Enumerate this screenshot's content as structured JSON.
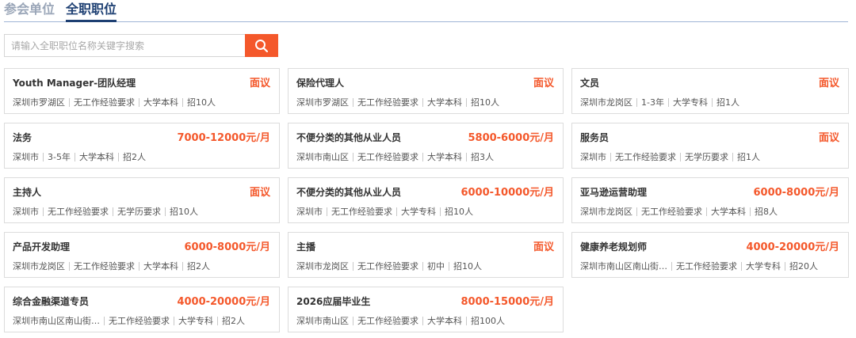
{
  "tabs": [
    {
      "label": "参会单位",
      "active": false
    },
    {
      "label": "全职职位",
      "active": true
    }
  ],
  "search": {
    "placeholder": "请输入全职职位名称关键字搜索",
    "value": ""
  },
  "colors": {
    "accent": "#f4582b",
    "tab_active": "#1d3f72",
    "tab_inactive": "#9aa6b8"
  },
  "jobs": [
    {
      "title": "Youth Manager-团队经理",
      "salary": "面议",
      "location": "深圳市罗湖区",
      "experience": "无工作经验要求",
      "education": "大学本科",
      "headcount": "招10人"
    },
    {
      "title": "保险代理人",
      "salary": "面议",
      "location": "深圳市罗湖区",
      "experience": "无工作经验要求",
      "education": "大学本科",
      "headcount": "招10人"
    },
    {
      "title": "文员",
      "salary": "面议",
      "location": "深圳市龙岗区",
      "experience": "1-3年",
      "education": "大学专科",
      "headcount": "招1人"
    },
    {
      "title": "法务",
      "salary": "7000-12000元/月",
      "location": "深圳市",
      "experience": "3-5年",
      "education": "大学本科",
      "headcount": "招2人"
    },
    {
      "title": "不便分类的其他从业人员",
      "salary": "5800-6000元/月",
      "location": "深圳市南山区",
      "experience": "无工作经验要求",
      "education": "大学本科",
      "headcount": "招3人"
    },
    {
      "title": "服务员",
      "salary": "面议",
      "location": "深圳市",
      "experience": "无工作经验要求",
      "education": "无学历要求",
      "headcount": "招1人"
    },
    {
      "title": "主持人",
      "salary": "面议",
      "location": "深圳市",
      "experience": "无工作经验要求",
      "education": "无学历要求",
      "headcount": "招10人"
    },
    {
      "title": "不便分类的其他从业人员",
      "salary": "6000-10000元/月",
      "location": "深圳市",
      "experience": "无工作经验要求",
      "education": "大学专科",
      "headcount": "招10人"
    },
    {
      "title": "亚马逊运营助理",
      "salary": "6000-8000元/月",
      "location": "深圳市龙岗区",
      "experience": "无工作经验要求",
      "education": "大学本科",
      "headcount": "招8人"
    },
    {
      "title": "产品开发助理",
      "salary": "6000-8000元/月",
      "location": "深圳市龙岗区",
      "experience": "无工作经验要求",
      "education": "大学本科",
      "headcount": "招2人"
    },
    {
      "title": "主播",
      "salary": "面议",
      "location": "深圳市龙岗区",
      "experience": "无工作经验要求",
      "education": "初中",
      "headcount": "招10人"
    },
    {
      "title": "健康养老规划师",
      "salary": "4000-20000元/月",
      "location": "深圳市南山区南山街道...",
      "experience": "无工作经验要求",
      "education": "大学专科",
      "headcount": "招20人"
    },
    {
      "title": "综合金融渠道专员",
      "salary": "4000-20000元/月",
      "location": "深圳市南山区南山街道...",
      "experience": "无工作经验要求",
      "education": "大学专科",
      "headcount": "招2人"
    },
    {
      "title": "2026应届毕业生",
      "salary": "8000-15000元/月",
      "location": "深圳市南山区",
      "experience": "无工作经验要求",
      "education": "大学本科",
      "headcount": "招100人"
    }
  ]
}
